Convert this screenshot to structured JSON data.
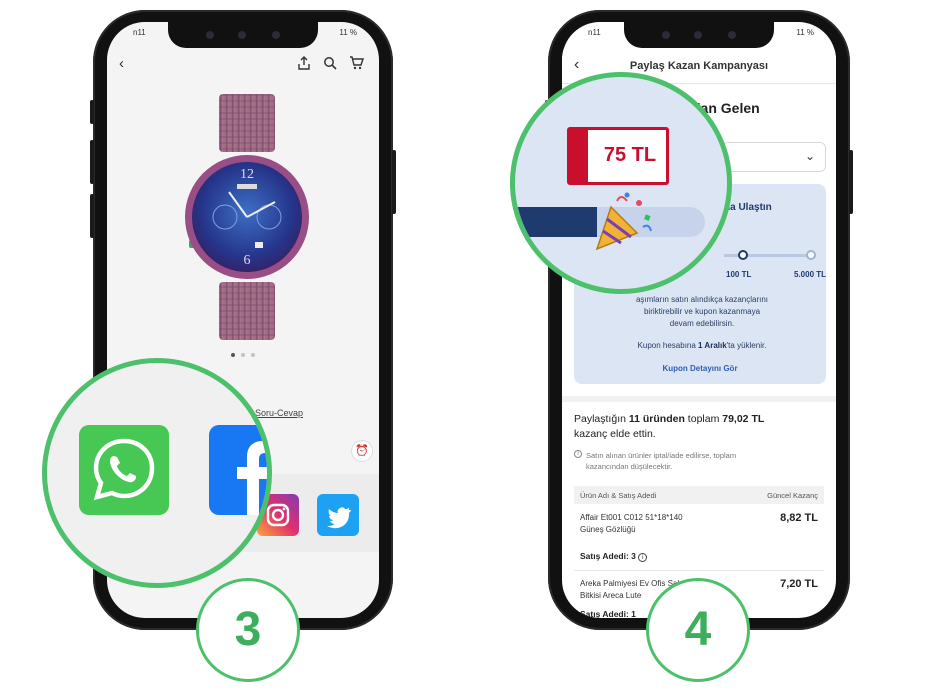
{
  "phone_left": {
    "status_left": "n11",
    "status_right": "11 %",
    "product_info_link": "15 Soru-Cevap",
    "share_apps": [
      "whatsapp-icon",
      "facebook-icon",
      "instagram-icon",
      "twitter-icon"
    ],
    "step_number": "3"
  },
  "phone_right": {
    "status_left": "n11",
    "status_right": "11 %",
    "header_title": "Paylaş Kazan Kampanyası",
    "heading_partial": "dan Gelen",
    "card_header_partial": "na Ulaştın",
    "tier_labels": [
      "100 TL",
      "5.000 TL"
    ],
    "coupon_amount": "75 TL",
    "info_text_line1": "aşımların satın alındıkça kazançlarını",
    "info_text_line2": "biriktirebilir ve kupon kazanmaya",
    "info_text_line3": "devam edebilirsin.",
    "coupon_load_prefix": "Kupon hesabına ",
    "coupon_load_date": "1 Aralık",
    "coupon_load_suffix": "'ta yüklenir.",
    "coupon_detail_link": "Kupon Detayını Gör",
    "earn_prefix": "Paylaştığın ",
    "earn_count": "11 üründen",
    "earn_mid": " toplam ",
    "earn_total": "79,02 TL",
    "earn_suffix": "kazanç elde ettin.",
    "note_line1": "Satın alınan ürünler iptal/iade edilirse, toplam",
    "note_line2": "kazancından düşülecektir.",
    "table_headers": {
      "product": "Ürün Adı & Satış Adedi",
      "earning": "Güncel Kazanç"
    },
    "rows": [
      {
        "name_line1": "Affair Et001 C012 51*18*140",
        "name_line2": "Güneş Gözlüğü",
        "price": "8,82 TL",
        "qty": "Satış Adedi: 3"
      },
      {
        "name_line1": "Areka Palmiyesi Ev Ofis Salon",
        "name_line2": "Bitkisi Areca Lute",
        "price": "7,20 TL",
        "qty": "Satış Adedi: 1"
      }
    ],
    "step_number": "4"
  },
  "colors": {
    "accent_green": "#4cc06b",
    "coupon_red": "#c8102e",
    "card_blue": "#dbe5f3",
    "navy": "#1e3a6e",
    "whatsapp": "#47c753",
    "facebook": "#1877f2",
    "twitter": "#1da1f2"
  }
}
